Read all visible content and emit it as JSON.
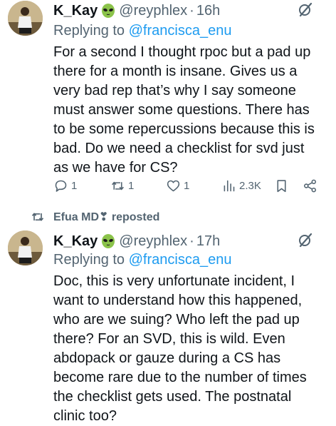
{
  "tweet1": {
    "name": "K_Kay",
    "handle": "@reyphlex",
    "dot": "·",
    "time": "16h",
    "replying_prefix": "Replying to ",
    "replying_to": "@francisca_enu",
    "lines": [
      "For a second I thought rpoc but a pad up",
      "there for a month is insane. Gives us a",
      "very bad rep that’s why I say someone",
      "must answer some questions. There has",
      "to be some repercussions because this is",
      "bad. Do we need a checklist for svd just",
      "as we have for CS?"
    ],
    "replies": "1",
    "reposts": "1",
    "likes": "1",
    "views": "2.3K"
  },
  "repost_bar": {
    "label": "Efua MD❣ reposted"
  },
  "tweet2": {
    "name": "K_Kay",
    "handle": "@reyphlex",
    "dot": "·",
    "time": "17h",
    "replying_prefix": "Replying to ",
    "replying_to": "@francisca_enu",
    "lines": [
      "Doc, this is very unfortunate incident, I",
      "want to understand how this happened,",
      "who are we suing? Who left the pad up",
      "there? For an SVD, this is wild. Even",
      "abdopack or gauze during a CS has",
      "become rare due to the number of times",
      "the checklist gets used. The postnatal",
      "clinic too?"
    ]
  },
  "colors": {
    "text": "#0f1419",
    "muted": "#536471",
    "link": "#1d9bf0",
    "alien_green": "#8bc34a"
  },
  "icons": {
    "name_badge": "alien-icon",
    "grok": "grok-slash-icon",
    "reply": "reply-bubble-icon",
    "repost": "repost-icon",
    "like": "heart-icon",
    "views": "views-bar-chart-icon",
    "bookmark": "bookmark-icon",
    "share": "share-icon"
  }
}
